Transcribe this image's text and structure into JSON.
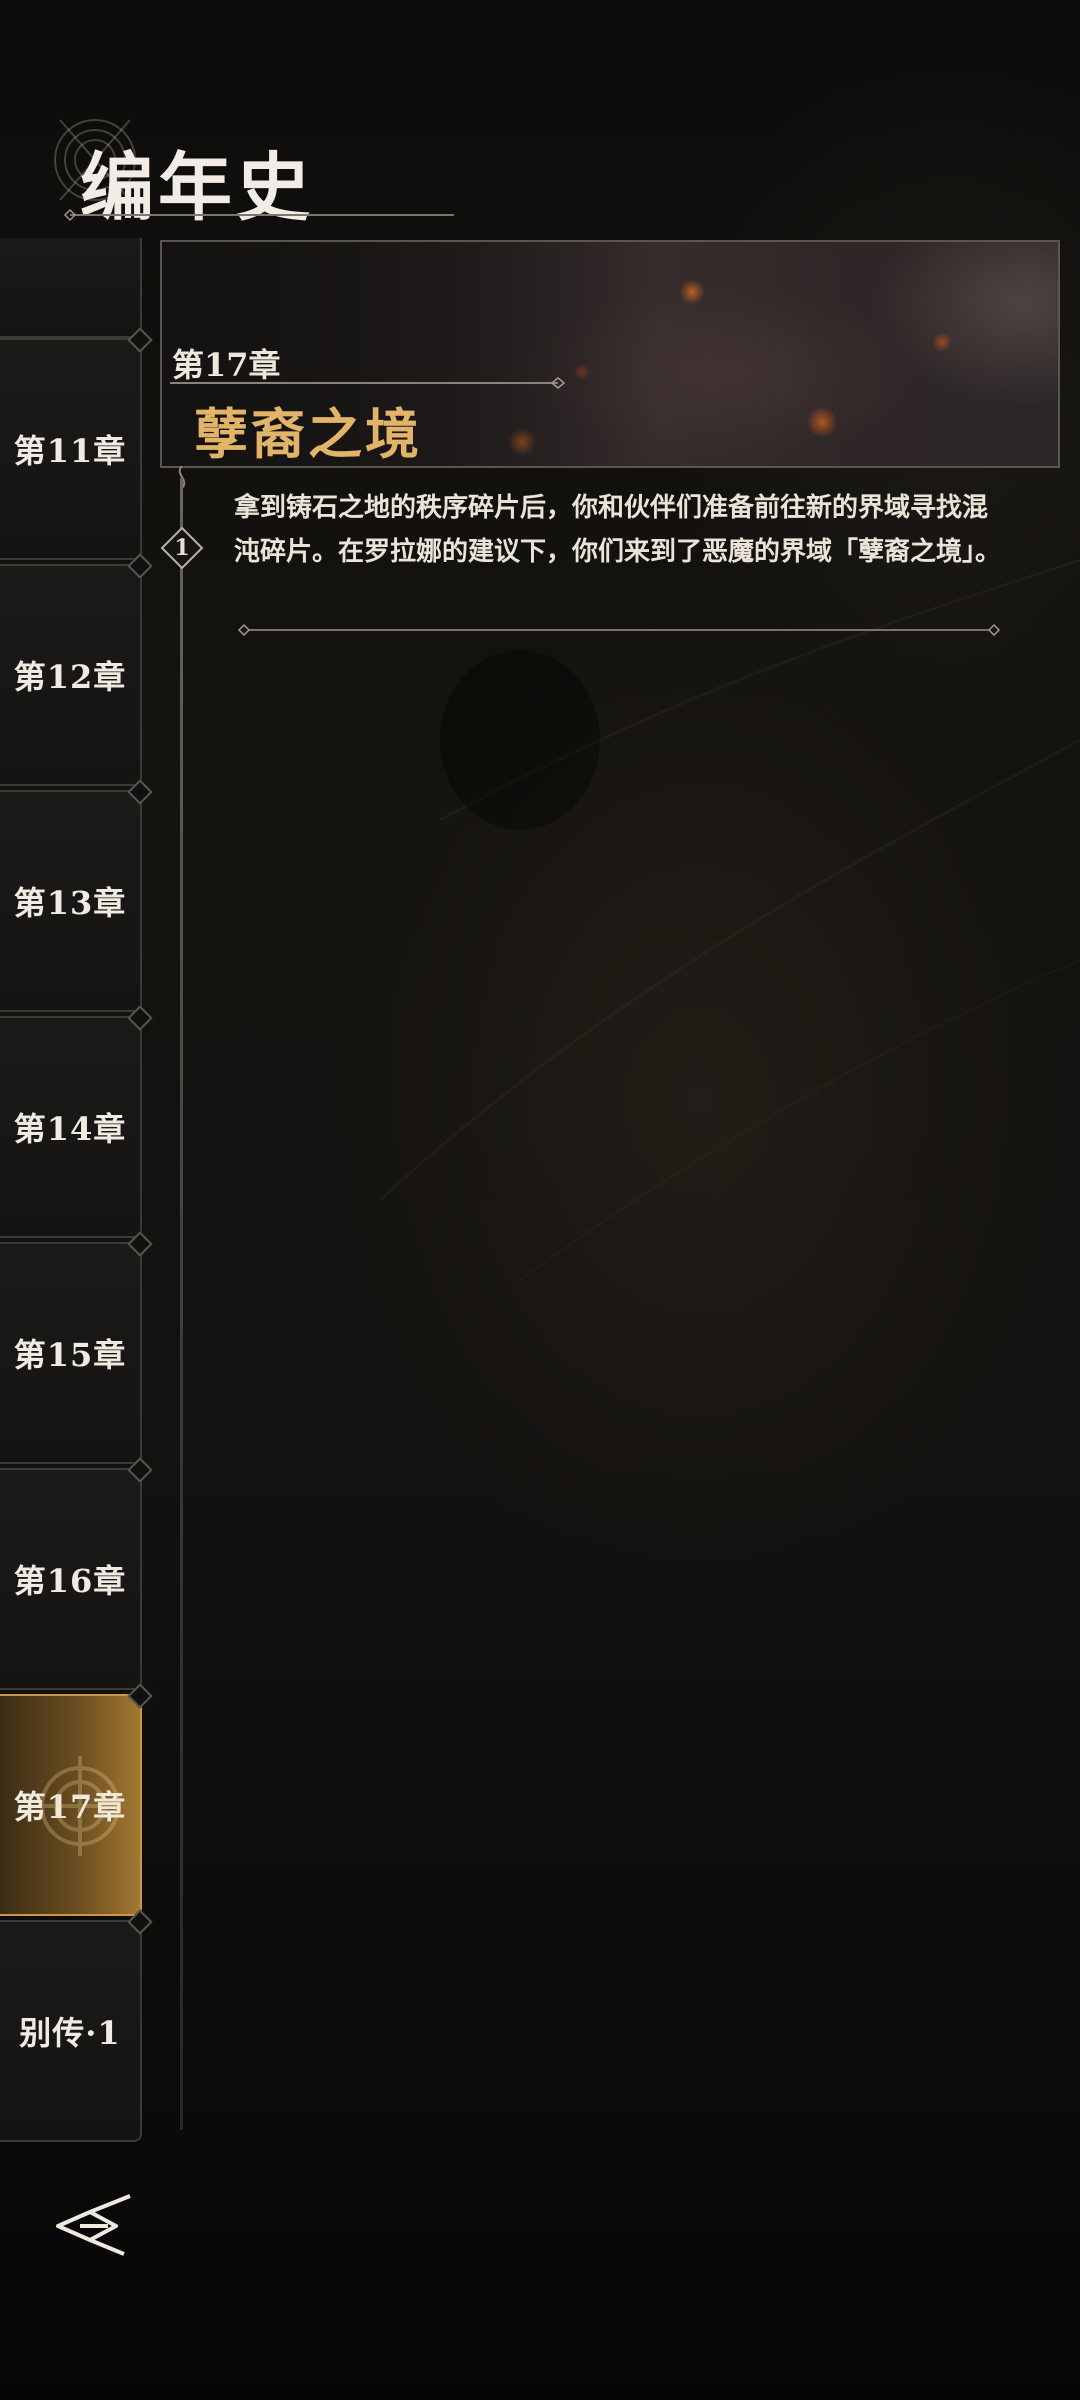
{
  "header": {
    "title": "编年史"
  },
  "sidebar": {
    "items": [
      {
        "label": "第11章"
      },
      {
        "label": "第12章"
      },
      {
        "label": "第13章"
      },
      {
        "label": "第14章"
      },
      {
        "label": "第15章"
      },
      {
        "label": "第16章"
      },
      {
        "label": "第17章",
        "active": true
      },
      {
        "label": "别传·1"
      }
    ],
    "active_color": "#a27832"
  },
  "banner": {
    "chapter": "第17章",
    "title": "孽裔之境",
    "title_color": "#e1b46a"
  },
  "entries": [
    {
      "number": "1",
      "text": "拿到铸石之地的秩序碎片后，你和伙伴们准备前往新的界域寻找混沌碎片。在罗拉娜的建议下，你们来到了恶魔的界域「孽裔之境」。"
    }
  ],
  "icons": {
    "back": "back-arrow-icon"
  }
}
